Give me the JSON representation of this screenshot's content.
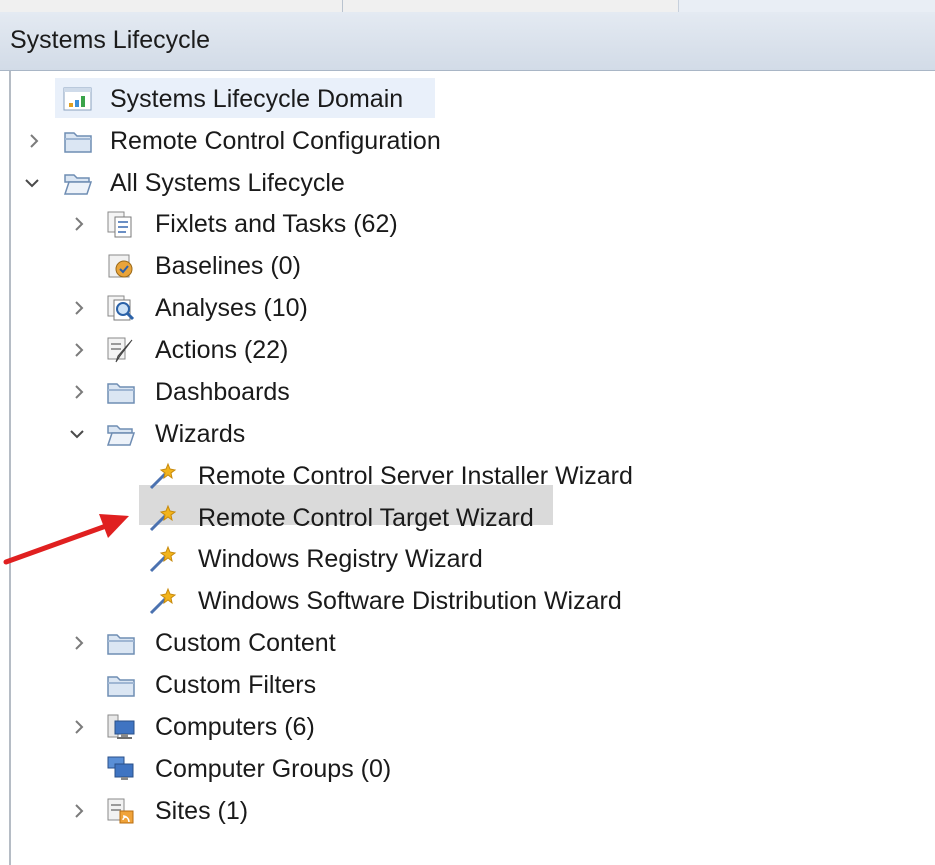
{
  "header": {
    "title": "Systems Lifecycle"
  },
  "colors": {
    "arrow": "#e02020",
    "selected_row": "#dadada",
    "header_bg": "#d8e0ea"
  },
  "tree": [
    {
      "label": "Systems Lifecycle Domain",
      "icon": "domain-chart-icon",
      "expander": "none"
    },
    {
      "label": "Remote Control Configuration",
      "icon": "folder-icon",
      "expander": "collapsed"
    },
    {
      "label": "All Systems Lifecycle",
      "icon": "folder-open-icon",
      "expander": "expanded"
    },
    {
      "label": "Fixlets and Tasks (62)",
      "icon": "fixlets-icon",
      "expander": "collapsed"
    },
    {
      "label": "Baselines (0)",
      "icon": "baselines-icon",
      "expander": "none"
    },
    {
      "label": "Analyses (10)",
      "icon": "analyses-icon",
      "expander": "collapsed"
    },
    {
      "label": "Actions (22)",
      "icon": "actions-icon",
      "expander": "collapsed"
    },
    {
      "label": "Dashboards",
      "icon": "folder-icon",
      "expander": "collapsed"
    },
    {
      "label": "Wizards",
      "icon": "folder-open-icon",
      "expander": "expanded"
    },
    {
      "label": "Remote Control Server Installer Wizard",
      "icon": "wizard-wand-icon",
      "expander": "none"
    },
    {
      "label": "Remote Control Target Wizard",
      "icon": "wizard-wand-icon",
      "expander": "none",
      "selected": true
    },
    {
      "label": "Windows Registry Wizard",
      "icon": "wizard-wand-icon",
      "expander": "none"
    },
    {
      "label": "Windows Software Distribution Wizard",
      "icon": "wizard-wand-icon",
      "expander": "none"
    },
    {
      "label": "Custom Content",
      "icon": "folder-icon",
      "expander": "collapsed"
    },
    {
      "label": "Custom Filters",
      "icon": "folder-icon",
      "expander": "none"
    },
    {
      "label": "Computers (6)",
      "icon": "computers-icon",
      "expander": "collapsed"
    },
    {
      "label": "Computer Groups (0)",
      "icon": "computer-groups-icon",
      "expander": "none"
    },
    {
      "label": "Sites (1)",
      "icon": "sites-icon",
      "expander": "collapsed"
    }
  ]
}
